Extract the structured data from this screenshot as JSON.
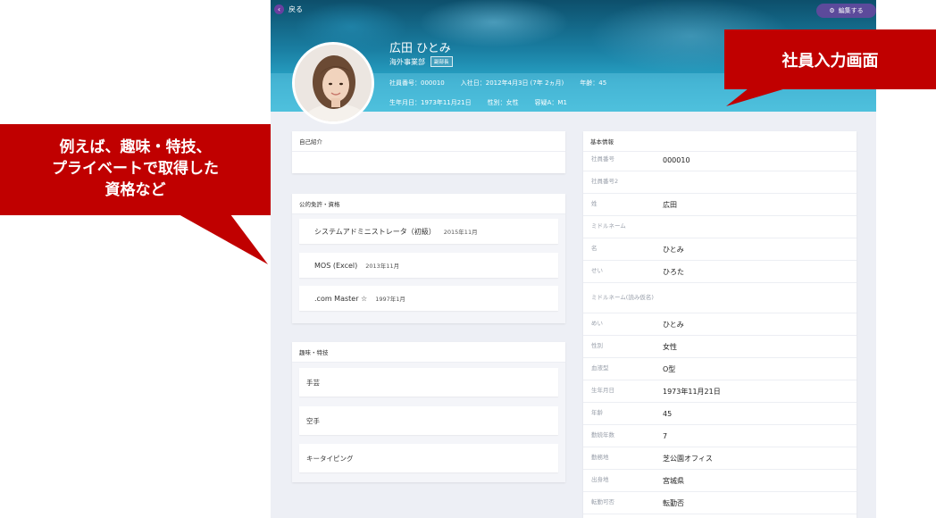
{
  "header": {
    "back_label": "戻る",
    "edit_label": "編集する",
    "name": "広田 ひとみ",
    "department": "海外事業部",
    "role": "副部長",
    "meta_row_1": [
      "社員番号：000010",
      "入社日：2012年4月3日 (7年 2ヵ月)",
      "年齢：45"
    ],
    "meta_row_2": [
      "生年月日：1973年11月21日",
      "性別：女性",
      "容疑A：M1"
    ]
  },
  "intro": {
    "title": "自己紹介"
  },
  "licenses": {
    "title": "公的免許・資格",
    "items": [
      {
        "name": "システムアドミニストレータ（初級）",
        "date": "2015年11月"
      },
      {
        "name": "MOS (Excel)",
        "date": "2013年11月"
      },
      {
        "name": ".com Master ☆",
        "date": "1997年1月"
      }
    ]
  },
  "hobbies": {
    "title": "趣味・特技",
    "items": [
      "手芸",
      "空手",
      "キータイピング"
    ]
  },
  "basic_info": {
    "title": "基本情報",
    "rows": [
      {
        "label": "社員番号",
        "value": "000010"
      },
      {
        "label": "社員番号2",
        "value": ""
      },
      {
        "label": "姓",
        "value": "広田"
      },
      {
        "label": "ミドルネーム",
        "value": ""
      },
      {
        "label": "名",
        "value": "ひとみ"
      },
      {
        "label": "せい",
        "value": "ひろた"
      },
      {
        "label": "ミドルネーム(読み仮名)",
        "value": ""
      },
      {
        "label": "めい",
        "value": "ひとみ"
      },
      {
        "label": "性別",
        "value": "女性"
      },
      {
        "label": "血液型",
        "value": "O型"
      },
      {
        "label": "生年月日",
        "value": "1973年11月21日"
      },
      {
        "label": "年齢",
        "value": "45"
      },
      {
        "label": "勤続年数",
        "value": "7"
      },
      {
        "label": "勤務地",
        "value": "芝公園オフィス"
      },
      {
        "label": "出身地",
        "value": "宮城県"
      },
      {
        "label": "転勤可否",
        "value": "転勤否"
      }
    ]
  },
  "callouts": {
    "left_lines": [
      "例えば、趣味・特技、",
      "プライベートで取得した",
      "資格など"
    ],
    "right": "社員入力画面"
  },
  "colors": {
    "callout": "#c00000",
    "edit_button": "#5c4a9b",
    "back_button": "#6a3fa0"
  }
}
